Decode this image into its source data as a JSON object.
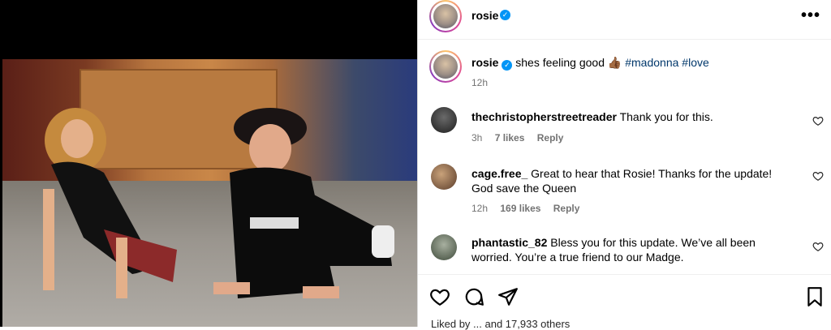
{
  "post": {
    "author": "rosie",
    "caption": "shes feeling good",
    "emoji": "👍🏾",
    "hashtags": [
      "#madonna",
      "#love"
    ],
    "time": "12h"
  },
  "comments": [
    {
      "user": "thechristopherstreetreader",
      "text": "Thank you for this.",
      "time": "3h",
      "likes": "7 likes",
      "reply": "Reply"
    },
    {
      "user": "cage.free_",
      "text": "Great to hear that Rosie! Thanks for the update! God save the Queen",
      "time": "12h",
      "likes": "169 likes",
      "reply": "Reply"
    },
    {
      "user": "phantastic_82",
      "text": "Bless you for this update. We’ve all been worried. You’re a true friend to our Madge."
    }
  ],
  "footer": {
    "liked_by": "Liked by ... and 17,933 others"
  },
  "colors": {
    "verified": "#0095f6",
    "hashtag": "#00376b",
    "meta": "#737373"
  },
  "icons": [
    "more-options-icon",
    "heart-icon",
    "comment-icon",
    "share-icon",
    "bookmark-icon",
    "verified-badge-icon"
  ]
}
